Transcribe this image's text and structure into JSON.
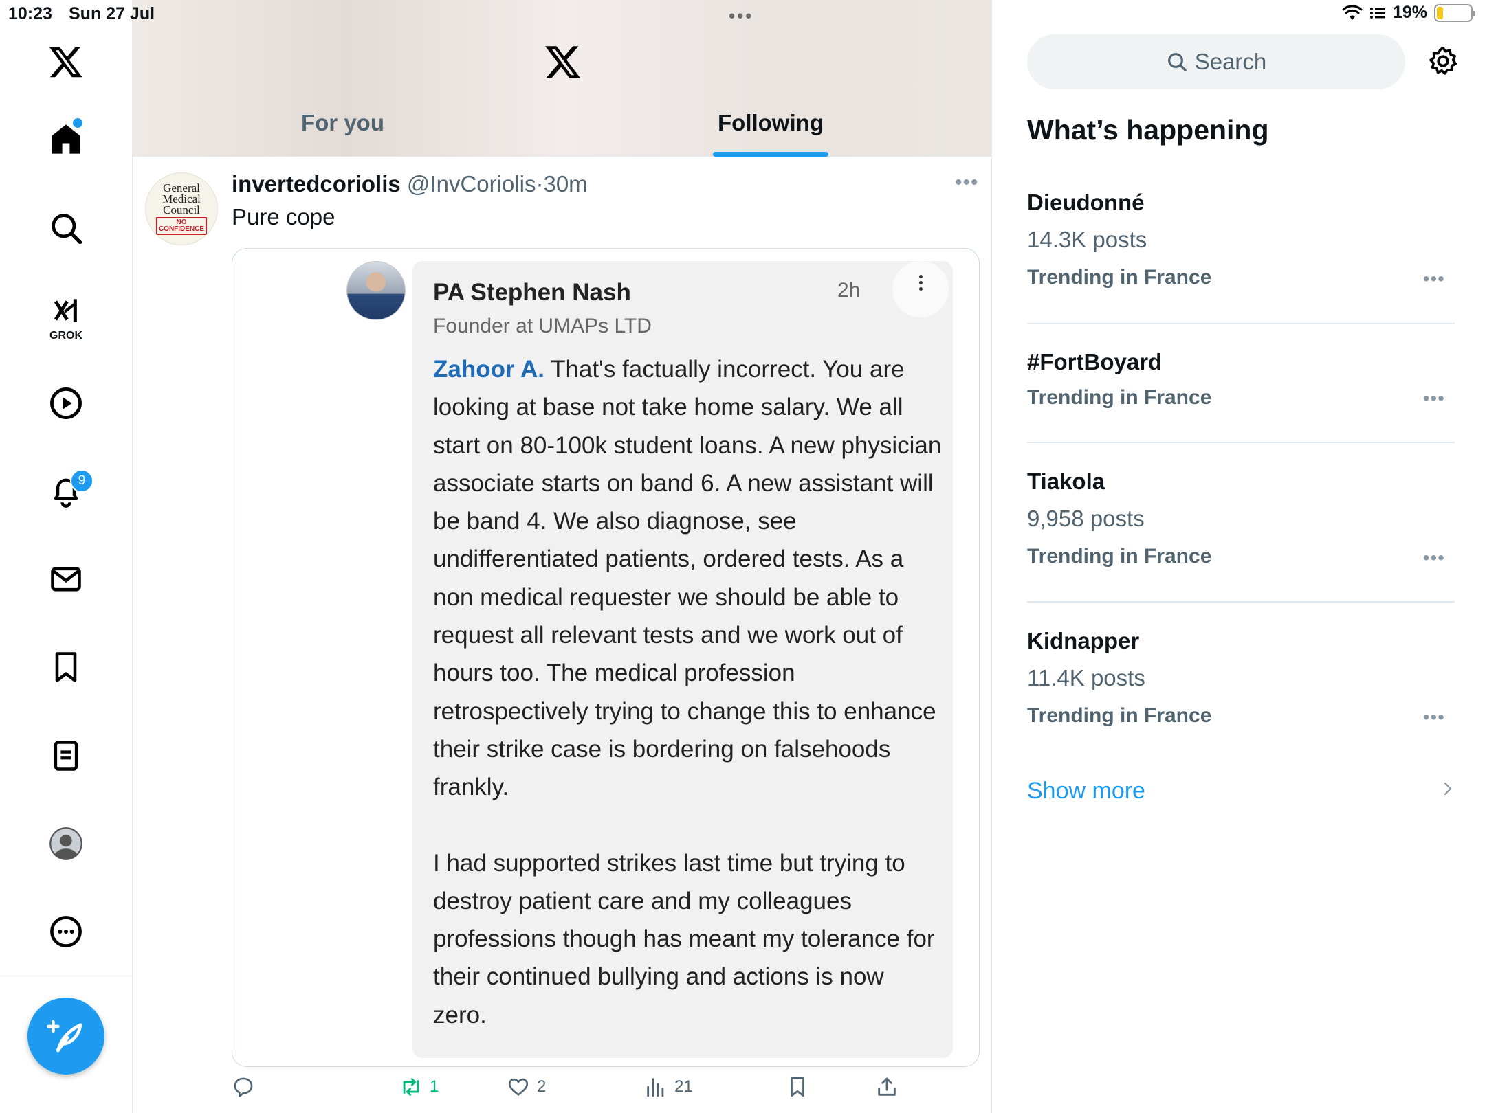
{
  "status_bar": {
    "time": "10:23",
    "date": "Sun 27 Jul",
    "battery": "19%",
    "battery_level": 0.19
  },
  "nav": {
    "notifications_badge": "9",
    "grok_label": "GROK",
    "items": [
      "home-icon",
      "search-icon",
      "grok-icon",
      "video-icon",
      "bell-icon",
      "mail-icon",
      "bookmark-icon",
      "lists-icon",
      "profile-icon",
      "more-icon"
    ]
  },
  "header": {
    "tabs": [
      {
        "label": "For you"
      },
      {
        "label": "Following"
      }
    ],
    "active_tab": "Following"
  },
  "tweet": {
    "avatar_text": [
      "General",
      "Medical",
      "Council"
    ],
    "avatar_stamp": [
      "NO",
      "CONFIDENCE"
    ],
    "name": "invertedcoriolis",
    "handle": "@InvCoriolis",
    "separator": "·",
    "time": "30m",
    "text": "Pure cope",
    "quote": {
      "name": "PA Stephen Nash",
      "subtitle": "Founder at UMAPs LTD",
      "time": "2h",
      "mention": "Zahoor A.",
      "paragraph1": "That's factually incorrect. You are looking at base not take home salary. We all start on 80-100k student loans. A new physician associate starts on band 6. A new assistant will be band 4. We also diagnose, see undifferentiated patients, ordered tests. As a non medical requester we should be able to request all relevant tests and we work out of hours too. The medical profession retrospectively trying to change this to enhance their strike case is bordering on falsehoods frankly.",
      "paragraph2": "I had supported strikes last time but trying to destroy patient care and my colleagues professions though has meant my tolerance for their continued bullying and actions is now zero."
    },
    "actions": {
      "replies": "",
      "reposts": "1",
      "likes": "2",
      "views": "21"
    },
    "colors": {
      "repost_active": "#00ba7c",
      "accent": "#1d9bf0"
    }
  },
  "sidebar": {
    "search_placeholder": "Search",
    "title": "What’s happening",
    "trends": [
      {
        "name": "Dieudonné",
        "posts": "14.3K posts",
        "category": "Trending in France"
      },
      {
        "name": "#FortBoyard",
        "posts": "",
        "category": "Trending in France"
      },
      {
        "name": "Tiakola",
        "posts": "9,958 posts",
        "category": "Trending in France"
      },
      {
        "name": "Kidnapper",
        "posts": "11.4K posts",
        "category": "Trending in France"
      }
    ],
    "show_more": "Show more"
  }
}
